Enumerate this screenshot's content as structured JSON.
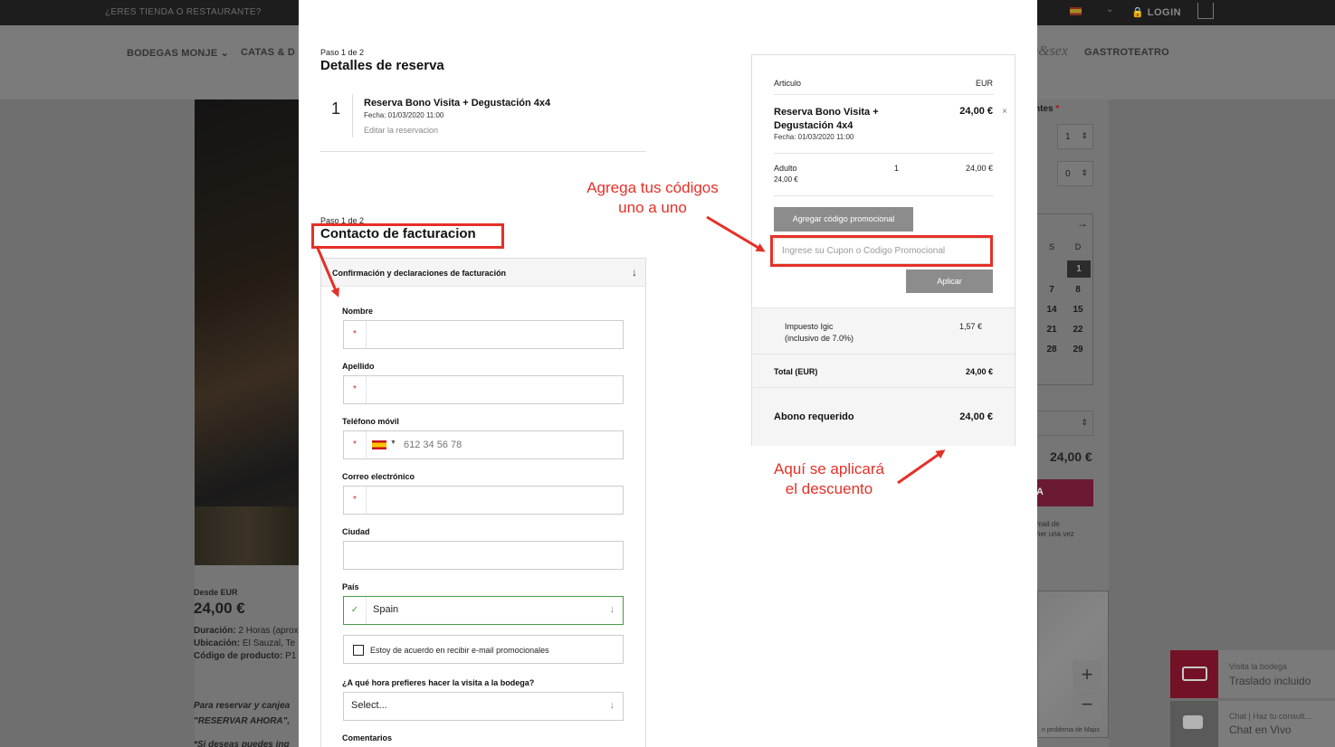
{
  "background": {
    "topbar": {
      "store_link": "¿ERES TIENDA O RESTAURANTE?",
      "login": "LOGIN"
    },
    "nav": {
      "items": [
        "BODEGAS MONJE",
        "CATAS & D"
      ],
      "brand": "e&sex",
      "gastroteatro": "GASTROTEATRO"
    },
    "product": {
      "from_label": "Desde EUR",
      "price": "24,00 €",
      "duration_label": "Duración:",
      "duration_value": " 2 Horas (aprox",
      "location_label": "Ubicación:",
      "location_value": " El Sauzal, Te",
      "code_label": "Código de producto:",
      "code_value": " P1",
      "reserve_text_1": "Para reservar y canjea",
      "reserve_text_2": "\"RESERVAR AHORA\",",
      "reserve_text_3": "*Si deseas puedes ing"
    },
    "booking_widget": {
      "participants_label": "ntes",
      "adult_qty": "1",
      "child_qty": "0",
      "cal_next": "→",
      "cal_days": [
        "S",
        "D"
      ],
      "cal_rows": [
        [
          "",
          "1"
        ],
        [
          "7",
          "8"
        ],
        [
          "14",
          "15"
        ],
        [
          "21",
          "22"
        ],
        [
          "28",
          "29"
        ]
      ],
      "total": "24,00 €",
      "reserve_btn": "A",
      "note_1": "mail de",
      "note_2": "her una vez",
      "map_error": "n problema de Maps"
    },
    "chat": {
      "bus_line1": "Visita la bodega",
      "bus_line2": "Traslado incluido",
      "chat_line1": "Chat | Haz tu consult...",
      "chat_line2": "Chat en Vivo"
    }
  },
  "modal": {
    "step1": {
      "step_label": "Paso 1 de 2",
      "title": "Detalles de reserva",
      "item_number": "1",
      "item_name": "Reserva Bono Visita + Degustación 4x4",
      "item_date": "Fecha: 01/03/2020   11:00",
      "edit_link": "Editar la reservacion"
    },
    "step2": {
      "step_label": "Paso 1 de 2",
      "title": "Contacto de facturacion",
      "accordion_title": "Confirmación y declaraciones de facturación",
      "fields": {
        "nombre_label": "Nombre",
        "apellido_label": "Apellido",
        "telefono_label": "Teléfono móvil",
        "telefono_placeholder": "612 34 56 78",
        "correo_label": "Correo electrónico",
        "ciudad_label": "Ciudad",
        "pais_label": "País",
        "pais_value": "Spain",
        "newsletter_label": "Estoy de acuerdo en recibir e-mail promocionales",
        "hora_label": "¿A qué hora prefieres hacer la visita a la bodega?",
        "hora_value": "Select...",
        "comentarios_label": "Comentarios"
      }
    },
    "summary": {
      "col_article": "Articulo",
      "col_currency": "EUR",
      "product_name": "Reserva Bono Visita + Degustación 4x4",
      "product_price": "24,00 €",
      "product_date": "Fecha: 01/03/2020   11:00",
      "adult_label": "Adulto",
      "adult_unit": "24,00 €",
      "adult_qty": "1",
      "adult_price": "24,00 €",
      "promo_button": "Agregar código promocional",
      "promo_placeholder": "Ingrese su Cupon o Codigo Promocional",
      "apply_button": "Aplicar",
      "tax_label": "Impuesto Igic",
      "tax_sub": "(inclusivo de 7.0%)",
      "tax_value": "1,57 €",
      "total_label": "Total (EUR)",
      "total_value": "24,00 €",
      "deposit_label": "Abono requerido",
      "deposit_value": "24,00 €"
    },
    "annotations": {
      "codes_line1": "Agrega tus códigos",
      "codes_line2": "uno a uno",
      "discount_line1": "Aquí se aplicará",
      "discount_line2": "el descuento"
    }
  },
  "colors": {
    "annotation_red": "#e53027",
    "valid_green": "#4a9a4a",
    "button_grey": "#8c8c8c"
  }
}
